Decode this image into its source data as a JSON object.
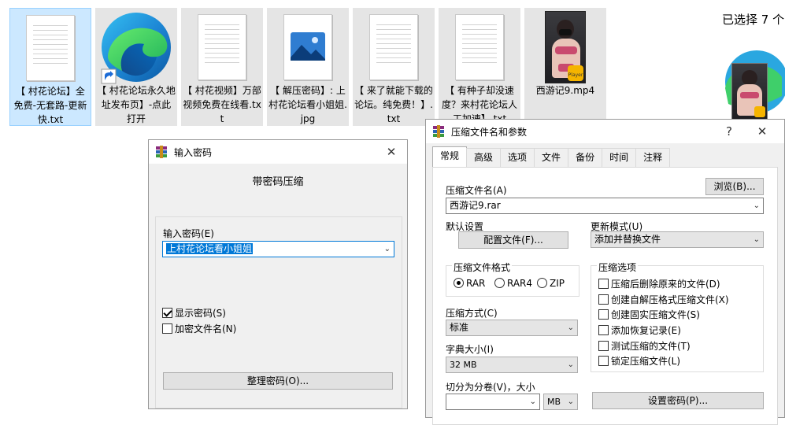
{
  "explorer": {
    "files": [
      {
        "name": "【 村花论坛】全免费-无套路-更新快.txt",
        "icon": "text-file-icon",
        "selected": true
      },
      {
        "name": "【 村花论坛永久地址发布页】-点此打开",
        "icon": "edge-shortcut-icon",
        "selected": false
      },
      {
        "name": "【 村花视频】万部视频免费在线看.txt",
        "icon": "text-file-icon",
        "selected": false
      },
      {
        "name": "【 解压密码】: 上村花论坛看小姐姐.jpg",
        "icon": "image-file-icon",
        "selected": false
      },
      {
        "name": "【 来了就能下载的论坛。纯免费！】.txt",
        "icon": "text-file-icon",
        "selected": false
      },
      {
        "name": "【 有种子却没速度？来村花论坛人工加速】.txt",
        "icon": "text-file-icon",
        "selected": false
      },
      {
        "name": "西游记9.mp4",
        "icon": "video-thumbnail-icon",
        "selected": false
      }
    ],
    "selection_count": "已选择 7 个",
    "thumb_badge": "Player"
  },
  "password_dialog": {
    "title": "输入密码",
    "heading": "带密码压缩",
    "password_label": "输入密码(E)",
    "password_value": "上村花论坛看小姐姐",
    "show_password_label": "显示密码(S)",
    "show_password_checked": true,
    "encrypt_names_label": "加密文件名(N)",
    "encrypt_names_checked": false,
    "organize_button": "整理密码(O)..."
  },
  "archive_dialog": {
    "title": "压缩文件名和参数",
    "help": "?",
    "close": "✕",
    "tabs": [
      "常规",
      "高级",
      "选项",
      "文件",
      "备份",
      "时间",
      "注释"
    ],
    "active_tab": "常规",
    "archive_name_label": "压缩文件名(A)",
    "browse_button": "浏览(B)...",
    "archive_name_value": "西游记9.rar",
    "default_settings_label": "默认设置",
    "profiles_button": "配置文件(F)...",
    "update_mode_label": "更新模式(U)",
    "update_mode_value": "添加并替换文件",
    "format_group_label": "压缩文件格式",
    "formats": [
      "RAR",
      "RAR4",
      "ZIP"
    ],
    "selected_format": "RAR",
    "method_label": "压缩方式(C)",
    "method_value": "标准",
    "dict_label": "字典大小(I)",
    "dict_value": "32 MB",
    "split_label": "切分为分卷(V)，大小",
    "split_unit": "MB",
    "options_group_label": "压缩选项",
    "options": [
      {
        "label": "压缩后删除原来的文件(D)",
        "checked": false
      },
      {
        "label": "创建自解压格式压缩文件(X)",
        "checked": false
      },
      {
        "label": "创建固实压缩文件(S)",
        "checked": false
      },
      {
        "label": "添加恢复记录(E)",
        "checked": false
      },
      {
        "label": "测试压缩的文件(T)",
        "checked": false
      },
      {
        "label": "锁定压缩文件(L)",
        "checked": false
      }
    ],
    "set_password_button": "设置密码(P)..."
  }
}
